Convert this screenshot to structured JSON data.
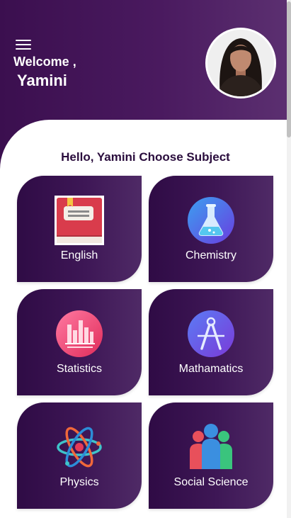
{
  "header": {
    "welcome": "Welcome ,",
    "username": "Yamini",
    "menu_icon": "hamburger-icon",
    "avatar": "user-profile-photo"
  },
  "main": {
    "greeting": "Hello, Yamini Choose Subject",
    "subjects": [
      {
        "label": "English",
        "icon": "book-icon"
      },
      {
        "label": "Chemistry",
        "icon": "flask-icon"
      },
      {
        "label": "Statistics",
        "icon": "bar-chart-icon"
      },
      {
        "label": "Mathamatics",
        "icon": "compass-icon"
      },
      {
        "label": "Physics",
        "icon": "atom-icon"
      },
      {
        "label": "Social Science",
        "icon": "people-icon"
      }
    ]
  },
  "colors": {
    "header_bg": "#3b0f4f",
    "card_bg": "#2f0b45",
    "greeting_text": "#2a0d3d"
  }
}
